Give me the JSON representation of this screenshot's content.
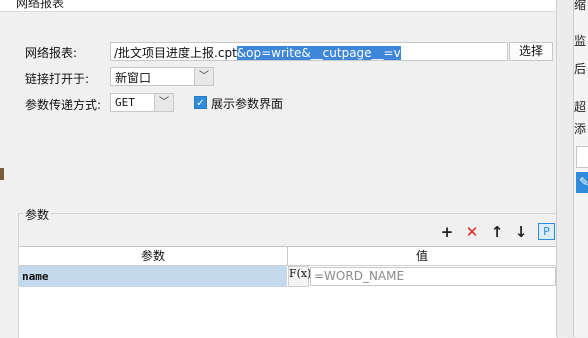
{
  "window": {
    "title": "网络报表"
  },
  "form": {
    "report_label": "网络报表:",
    "report_path_plain": "/批文项目进度上报.cpt",
    "report_path_selected": "&op=write&__cutpage__=v",
    "choose_button": "选择",
    "open_in_label": "链接打开于:",
    "open_in_value": "新窗口",
    "param_method_label": "参数传递方式:",
    "param_method_value": "GET",
    "show_params_label": "展示参数界面",
    "show_params_checked": true
  },
  "params": {
    "group_label": "参数",
    "toolbar": {
      "add_icon": "+",
      "delete_icon": "✕",
      "up_icon": "↑",
      "down_icon": "↓",
      "param_icon": "P"
    },
    "columns": [
      "参数",
      "值"
    ],
    "rows": [
      {
        "name": "name",
        "formula_button": "F(x)",
        "value": "=WORD_NAME"
      }
    ]
  },
  "right_panel": {
    "texts": [
      "缩",
      "监",
      "后",
      "超",
      "添"
    ],
    "button_icon": "✎"
  },
  "colors": {
    "selection": "#3d86d9",
    "row_highlight": "#c5d9ec",
    "delete_red": "#e0231b",
    "accent_blue": "#2f8cdd"
  }
}
